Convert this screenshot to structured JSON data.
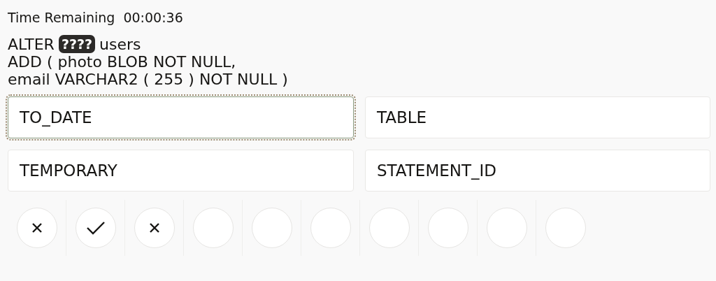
{
  "timer": {
    "label": "Time Remaining",
    "value": "00:00:36"
  },
  "question": {
    "before": "ALTER",
    "blank": "????",
    "after": "users",
    "lines": [
      "ADD ( photo BLOB NOT NULL,",
      "email VARCHAR2 ( 255 ) NOT NULL )"
    ]
  },
  "options": [
    {
      "label": "TO_DATE",
      "focused": true
    },
    {
      "label": "TABLE",
      "focused": false
    },
    {
      "label": "TEMPORARY",
      "focused": false
    },
    {
      "label": "STATEMENT_ID",
      "focused": false
    }
  ],
  "results": [
    {
      "kind": "wrong"
    },
    {
      "kind": "right"
    },
    {
      "kind": "wrong"
    },
    {
      "kind": "none"
    },
    {
      "kind": "none"
    },
    {
      "kind": "none"
    },
    {
      "kind": "none"
    },
    {
      "kind": "none"
    },
    {
      "kind": "none"
    },
    {
      "kind": "none"
    }
  ]
}
